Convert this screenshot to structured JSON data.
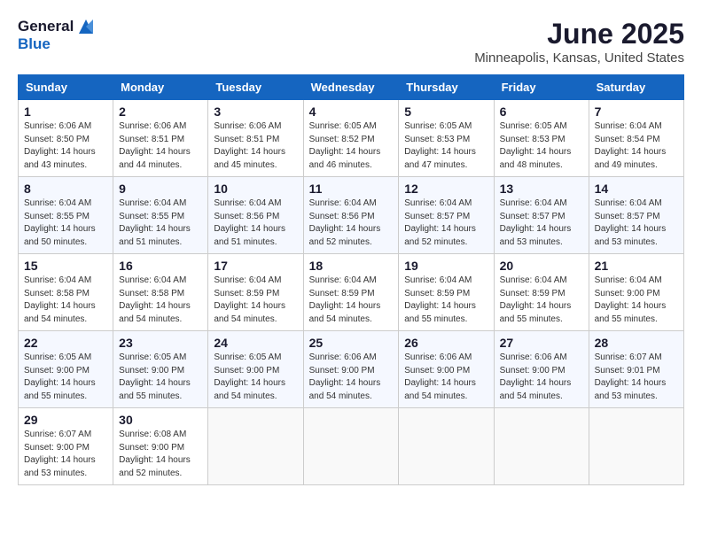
{
  "header": {
    "logo_general": "General",
    "logo_blue": "Blue",
    "month": "June 2025",
    "location": "Minneapolis, Kansas, United States"
  },
  "weekdays": [
    "Sunday",
    "Monday",
    "Tuesday",
    "Wednesday",
    "Thursday",
    "Friday",
    "Saturday"
  ],
  "weeks": [
    [
      {
        "day": "1",
        "sunrise": "6:06 AM",
        "sunset": "8:50 PM",
        "daylight": "14 hours and 43 minutes."
      },
      {
        "day": "2",
        "sunrise": "6:06 AM",
        "sunset": "8:51 PM",
        "daylight": "14 hours and 44 minutes."
      },
      {
        "day": "3",
        "sunrise": "6:06 AM",
        "sunset": "8:51 PM",
        "daylight": "14 hours and 45 minutes."
      },
      {
        "day": "4",
        "sunrise": "6:05 AM",
        "sunset": "8:52 PM",
        "daylight": "14 hours and 46 minutes."
      },
      {
        "day": "5",
        "sunrise": "6:05 AM",
        "sunset": "8:53 PM",
        "daylight": "14 hours and 47 minutes."
      },
      {
        "day": "6",
        "sunrise": "6:05 AM",
        "sunset": "8:53 PM",
        "daylight": "14 hours and 48 minutes."
      },
      {
        "day": "7",
        "sunrise": "6:04 AM",
        "sunset": "8:54 PM",
        "daylight": "14 hours and 49 minutes."
      }
    ],
    [
      {
        "day": "8",
        "sunrise": "6:04 AM",
        "sunset": "8:55 PM",
        "daylight": "14 hours and 50 minutes."
      },
      {
        "day": "9",
        "sunrise": "6:04 AM",
        "sunset": "8:55 PM",
        "daylight": "14 hours and 51 minutes."
      },
      {
        "day": "10",
        "sunrise": "6:04 AM",
        "sunset": "8:56 PM",
        "daylight": "14 hours and 51 minutes."
      },
      {
        "day": "11",
        "sunrise": "6:04 AM",
        "sunset": "8:56 PM",
        "daylight": "14 hours and 52 minutes."
      },
      {
        "day": "12",
        "sunrise": "6:04 AM",
        "sunset": "8:57 PM",
        "daylight": "14 hours and 52 minutes."
      },
      {
        "day": "13",
        "sunrise": "6:04 AM",
        "sunset": "8:57 PM",
        "daylight": "14 hours and 53 minutes."
      },
      {
        "day": "14",
        "sunrise": "6:04 AM",
        "sunset": "8:57 PM",
        "daylight": "14 hours and 53 minutes."
      }
    ],
    [
      {
        "day": "15",
        "sunrise": "6:04 AM",
        "sunset": "8:58 PM",
        "daylight": "14 hours and 54 minutes."
      },
      {
        "day": "16",
        "sunrise": "6:04 AM",
        "sunset": "8:58 PM",
        "daylight": "14 hours and 54 minutes."
      },
      {
        "day": "17",
        "sunrise": "6:04 AM",
        "sunset": "8:59 PM",
        "daylight": "14 hours and 54 minutes."
      },
      {
        "day": "18",
        "sunrise": "6:04 AM",
        "sunset": "8:59 PM",
        "daylight": "14 hours and 54 minutes."
      },
      {
        "day": "19",
        "sunrise": "6:04 AM",
        "sunset": "8:59 PM",
        "daylight": "14 hours and 55 minutes."
      },
      {
        "day": "20",
        "sunrise": "6:04 AM",
        "sunset": "8:59 PM",
        "daylight": "14 hours and 55 minutes."
      },
      {
        "day": "21",
        "sunrise": "6:04 AM",
        "sunset": "9:00 PM",
        "daylight": "14 hours and 55 minutes."
      }
    ],
    [
      {
        "day": "22",
        "sunrise": "6:05 AM",
        "sunset": "9:00 PM",
        "daylight": "14 hours and 55 minutes."
      },
      {
        "day": "23",
        "sunrise": "6:05 AM",
        "sunset": "9:00 PM",
        "daylight": "14 hours and 55 minutes."
      },
      {
        "day": "24",
        "sunrise": "6:05 AM",
        "sunset": "9:00 PM",
        "daylight": "14 hours and 54 minutes."
      },
      {
        "day": "25",
        "sunrise": "6:06 AM",
        "sunset": "9:00 PM",
        "daylight": "14 hours and 54 minutes."
      },
      {
        "day": "26",
        "sunrise": "6:06 AM",
        "sunset": "9:00 PM",
        "daylight": "14 hours and 54 minutes."
      },
      {
        "day": "27",
        "sunrise": "6:06 AM",
        "sunset": "9:00 PM",
        "daylight": "14 hours and 54 minutes."
      },
      {
        "day": "28",
        "sunrise": "6:07 AM",
        "sunset": "9:01 PM",
        "daylight": "14 hours and 53 minutes."
      }
    ],
    [
      {
        "day": "29",
        "sunrise": "6:07 AM",
        "sunset": "9:00 PM",
        "daylight": "14 hours and 53 minutes."
      },
      {
        "day": "30",
        "sunrise": "6:08 AM",
        "sunset": "9:00 PM",
        "daylight": "14 hours and 52 minutes."
      },
      null,
      null,
      null,
      null,
      null
    ]
  ],
  "labels": {
    "sunrise": "Sunrise:",
    "sunset": "Sunset:",
    "daylight": "Daylight:"
  }
}
